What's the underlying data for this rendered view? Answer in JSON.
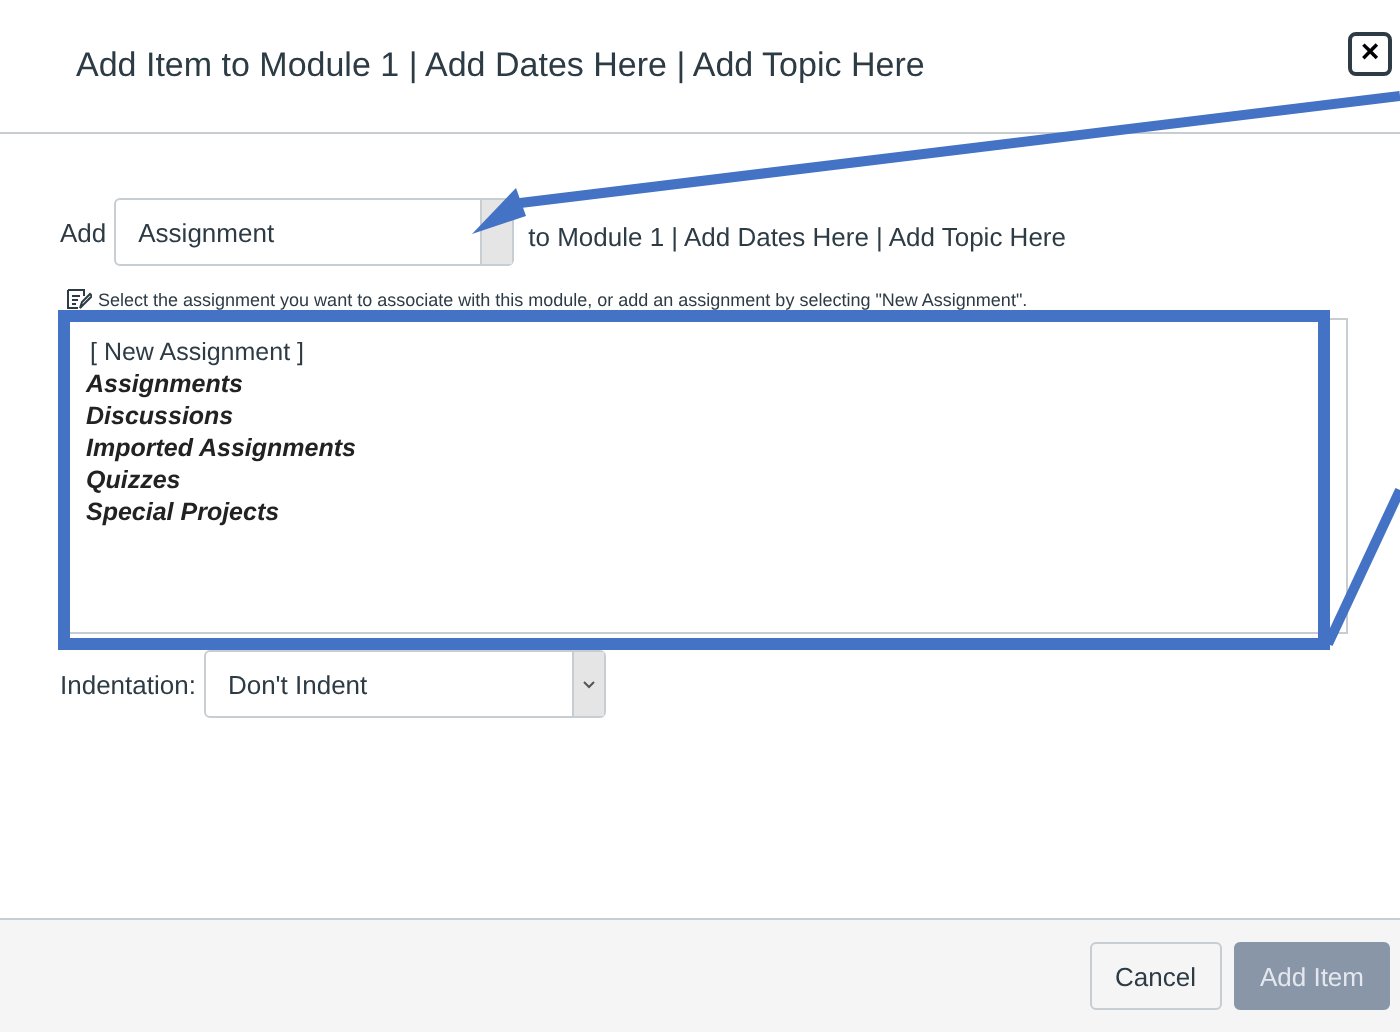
{
  "dialog": {
    "title": "Add Item to Module 1 | Add Dates Here | Add Topic Here",
    "close": "×"
  },
  "add_row": {
    "label": "Add",
    "type_select": "Assignment",
    "suffix": "to Module 1 | Add Dates Here | Add Topic Here"
  },
  "hint": "Select the assignment you want to associate with this module, or add an assignment by selecting \"New Assignment\".",
  "list": [
    {
      "kind": "option",
      "text": "[ New Assignment ]"
    },
    {
      "kind": "group",
      "text": "Assignments"
    },
    {
      "kind": "group",
      "text": "Discussions"
    },
    {
      "kind": "group",
      "text": "Imported Assignments"
    },
    {
      "kind": "group",
      "text": "Quizzes"
    },
    {
      "kind": "group",
      "text": "Special Projects"
    }
  ],
  "indentation": {
    "label": "Indentation:",
    "value": "Don't Indent"
  },
  "buttons": [
    {
      "label": "Cancel",
      "disabled": false
    },
    {
      "label": "Add Item",
      "disabled": true
    }
  ]
}
